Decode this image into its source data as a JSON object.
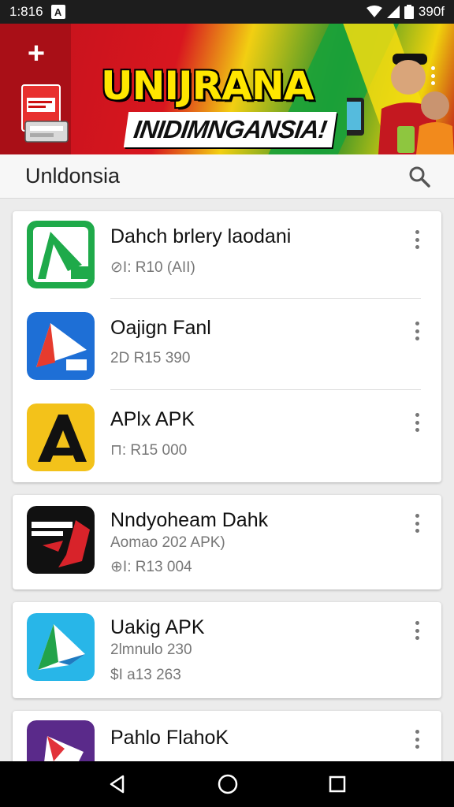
{
  "status_bar": {
    "time": "1:816",
    "notification_icon": "A",
    "battery": "390f"
  },
  "banner": {
    "title": "UNIJRANA",
    "subtitle": "INIDIMNGANSIA!"
  },
  "search": {
    "value": "Unldonsia",
    "icon": "search-icon"
  },
  "apps": [
    {
      "name": "Dahch brlery laodani",
      "meta1": "",
      "meta2": "⊘I: R10 (AII)",
      "icon_color": "#1faa4a"
    },
    {
      "name": "Oajign Fanl",
      "meta1": "",
      "meta2": "2D R15 390",
      "icon_color": "#1e6fd6"
    },
    {
      "name": "APlx APK",
      "meta1": "",
      "meta2": "⊓: R15 000",
      "icon_color": "#f3c21a"
    },
    {
      "name": "Nndyoheam Dahk",
      "meta1": "Aomao 202 APK)",
      "meta2": "⊕I: R13 004",
      "icon_color": "#111111"
    },
    {
      "name": "Uakig APK",
      "meta1": "2lmnulo 230",
      "meta2": "$I a13 263",
      "icon_color": "#28b6e8"
    },
    {
      "name": "Pahlo FlahoK",
      "meta1": "",
      "meta2": "",
      "icon_color": "#5a2a8a"
    }
  ],
  "colors": {
    "banner_red": "#d8161f",
    "banner_yellow": "#ffe600",
    "banner_green": "#1f8a2c"
  }
}
